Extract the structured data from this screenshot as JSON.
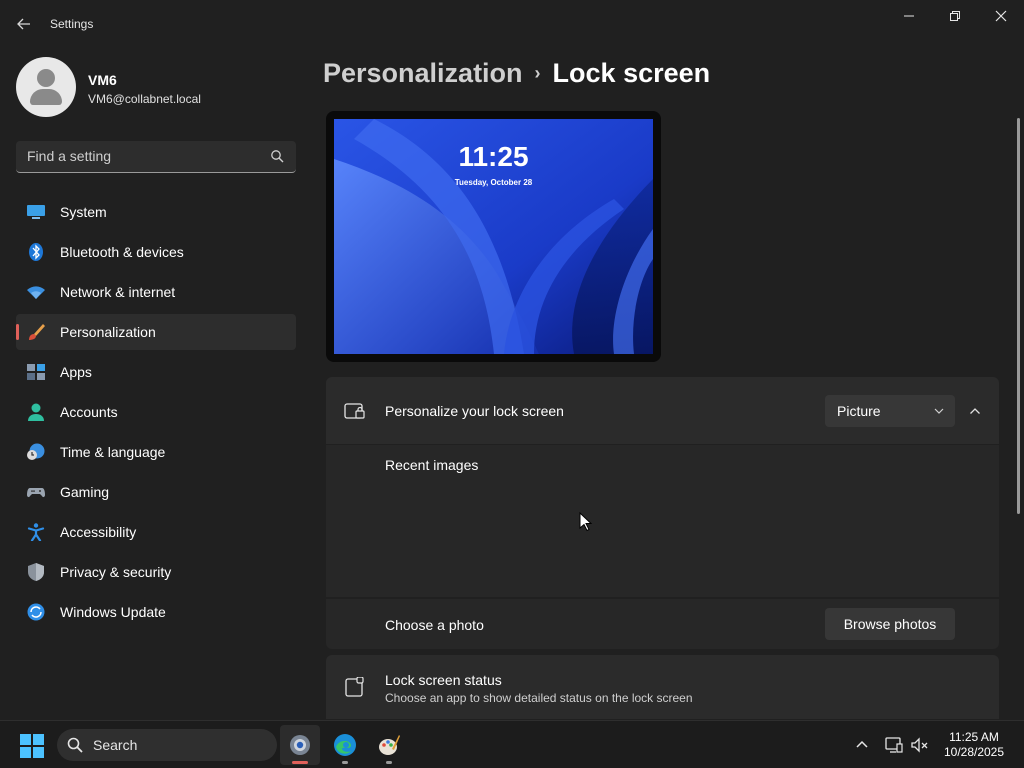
{
  "window": {
    "title": "Settings",
    "back_icon": "back-arrow-icon"
  },
  "profile": {
    "name": "VM6",
    "email": "VM6@collabnet.local"
  },
  "search": {
    "placeholder": "Find a setting"
  },
  "sidebar": {
    "items": [
      {
        "label": "System",
        "icon": "system-icon"
      },
      {
        "label": "Bluetooth & devices",
        "icon": "bluetooth-icon"
      },
      {
        "label": "Network & internet",
        "icon": "network-icon"
      },
      {
        "label": "Personalization",
        "icon": "personalization-brush-icon",
        "selected": true
      },
      {
        "label": "Apps",
        "icon": "apps-icon"
      },
      {
        "label": "Accounts",
        "icon": "accounts-icon"
      },
      {
        "label": "Time & language",
        "icon": "time-language-icon"
      },
      {
        "label": "Gaming",
        "icon": "gaming-icon"
      },
      {
        "label": "Accessibility",
        "icon": "accessibility-icon"
      },
      {
        "label": "Privacy & security",
        "icon": "shield-icon"
      },
      {
        "label": "Windows Update",
        "icon": "windows-update-icon"
      }
    ]
  },
  "breadcrumb": {
    "parent": "Personalization",
    "separator": "›",
    "current": "Lock screen"
  },
  "preview": {
    "time": "11:25",
    "date": "Tuesday, October 28"
  },
  "lock_screen": {
    "title": "Personalize your lock screen",
    "dropdown_value": "Picture",
    "recent_images_label": "Recent images",
    "choose_photo_label": "Choose a photo",
    "browse_button": "Browse photos",
    "status_title": "Lock screen status",
    "status_desc": "Choose an app to show detailed status on the lock screen"
  },
  "taskbar": {
    "search_label": "Search",
    "apps": [
      "settings-icon",
      "edge-icon",
      "paint-icon"
    ],
    "time": "11:25 AM",
    "date": "10/28/2025"
  },
  "colors": {
    "background": "#202020",
    "card": "#2b2b2b",
    "accent_indicator": "#e0605a",
    "wallpaper_blue": "#1b3fcf"
  }
}
